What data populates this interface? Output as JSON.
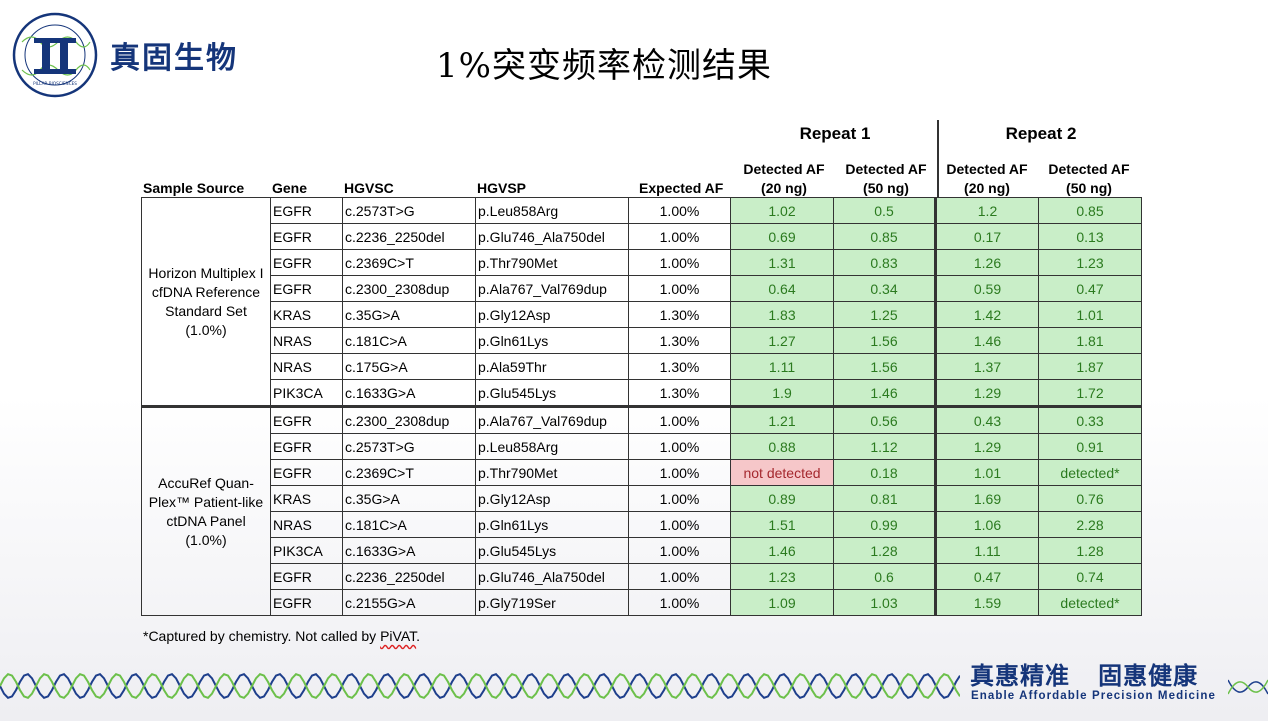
{
  "brand": {
    "name": "真固生物",
    "logo_text": "PILLAR BIOSCIENCES"
  },
  "title": "1%突变频率检测结果",
  "table": {
    "repeat_labels": [
      "Repeat 1",
      "Repeat 2"
    ],
    "headers": {
      "sample_source": "Sample Source",
      "gene": "Gene",
      "hgvsc": "HGVSC",
      "hgvsp": "HGVSP",
      "expected_af": "Expected AF",
      "af20_line1": "Detected AF",
      "af20_line2": "(20 ng)",
      "af50_line1": "Detected AF",
      "af50_line2": "(50 ng)"
    },
    "groups": [
      {
        "source_lines": [
          "Horizon Multiplex I",
          "cfDNA Reference",
          "Standard Set",
          "(1.0%)"
        ],
        "rows": [
          [
            "EGFR",
            "c.2573T>G",
            "p.Leu858Arg",
            "1.00%",
            "1.02",
            "0.5",
            "1.2",
            "0.85"
          ],
          [
            "EGFR",
            "c.2236_2250del",
            "p.Glu746_Ala750del",
            "1.00%",
            "0.69",
            "0.85",
            "0.17",
            "0.13"
          ],
          [
            "EGFR",
            "c.2369C>T",
            "p.Thr790Met",
            "1.00%",
            "1.31",
            "0.83",
            "1.26",
            "1.23"
          ],
          [
            "EGFR",
            "c.2300_2308dup",
            "p.Ala767_Val769dup",
            "1.00%",
            "0.64",
            "0.34",
            "0.59",
            "0.47"
          ],
          [
            "KRAS",
            "c.35G>A",
            "p.Gly12Asp",
            "1.30%",
            "1.83",
            "1.25",
            "1.42",
            "1.01"
          ],
          [
            "NRAS",
            "c.181C>A",
            "p.Gln61Lys",
            "1.30%",
            "1.27",
            "1.56",
            "1.46",
            "1.81"
          ],
          [
            "NRAS",
            "c.175G>A",
            "p.Ala59Thr",
            "1.30%",
            "1.11",
            "1.56",
            "1.37",
            "1.87"
          ],
          [
            "PIK3CA",
            "c.1633G>A",
            "p.Glu545Lys",
            "1.30%",
            "1.9",
            "1.46",
            "1.29",
            "1.72"
          ]
        ]
      },
      {
        "source_lines": [
          "AccuRef Quan-",
          "Plex™ Patient-like",
          "ctDNA Panel",
          "(1.0%)"
        ],
        "rows": [
          [
            "EGFR",
            "c.2300_2308dup",
            "p.Ala767_Val769dup",
            "1.00%",
            "1.21",
            "0.56",
            "0.43",
            "0.33"
          ],
          [
            "EGFR",
            "c.2573T>G",
            "p.Leu858Arg",
            "1.00%",
            "0.88",
            "1.12",
            "1.29",
            "0.91"
          ],
          [
            "EGFR",
            "c.2369C>T",
            "p.Thr790Met",
            "1.00%",
            "not detected",
            "0.18",
            "1.01",
            "detected*"
          ],
          [
            "KRAS",
            "c.35G>A",
            "p.Gly12Asp",
            "1.00%",
            "0.89",
            "0.81",
            "1.69",
            "0.76"
          ],
          [
            "NRAS",
            "c.181C>A",
            "p.Gln61Lys",
            "1.00%",
            "1.51",
            "0.99",
            "1.06",
            "2.28"
          ],
          [
            "PIK3CA",
            "c.1633G>A",
            "p.Glu545Lys",
            "1.00%",
            "1.46",
            "1.28",
            "1.11",
            "1.28"
          ],
          [
            "EGFR",
            "c.2236_2250del",
            "p.Glu746_Ala750del",
            "1.00%",
            "1.23",
            "0.6",
            "0.47",
            "0.74"
          ],
          [
            "EGFR",
            "c.2155G>A",
            "p.Gly719Ser",
            "1.00%",
            "1.09",
            "1.03",
            "1.59",
            "detected*"
          ]
        ]
      }
    ]
  },
  "footnote": {
    "prefix": "*Captured by chemistry. Not called by ",
    "term": "PiVAT",
    "suffix": "."
  },
  "slogan": {
    "cn": "真惠精准   固惠健康",
    "en": "Enable Affordable Precision Medicine"
  },
  "colors": {
    "brand_blue": "#15357a",
    "cell_green_bg": "#c9eec8",
    "cell_green_text": "#2b7a1f",
    "cell_red_bg": "#f6c7c9",
    "cell_red_text": "#a5282e",
    "dna_blue": "#1e3f8c",
    "dna_green": "#6cc04a"
  }
}
